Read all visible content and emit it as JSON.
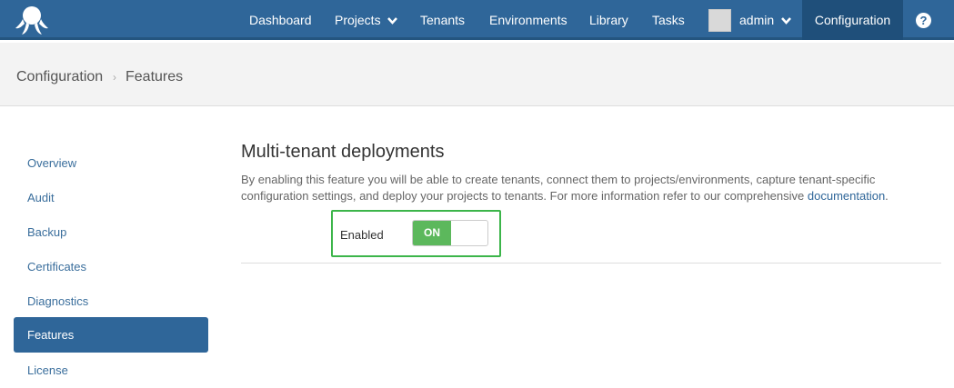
{
  "nav": {
    "items": [
      {
        "label": "Dashboard"
      },
      {
        "label": "Projects"
      },
      {
        "label": "Tenants"
      },
      {
        "label": "Environments"
      },
      {
        "label": "Library"
      },
      {
        "label": "Tasks"
      }
    ],
    "user": "admin",
    "configuration": "Configuration",
    "help": "?"
  },
  "breadcrumb": {
    "parent": "Configuration",
    "current": "Features"
  },
  "sidebar": {
    "items": [
      {
        "label": "Overview"
      },
      {
        "label": "Audit"
      },
      {
        "label": "Backup"
      },
      {
        "label": "Certificates"
      },
      {
        "label": "Diagnostics"
      },
      {
        "label": "Features",
        "active": true
      },
      {
        "label": "License"
      }
    ]
  },
  "feature": {
    "title": "Multi-tenant deployments",
    "description": "By enabling this feature you will be able to create tenants, connect them to projects/environments, capture tenant-specific configuration settings, and deploy your projects to tenants. For more information refer to our comprehensive",
    "link": "documentation",
    "link_suffix": ".",
    "toggle_label": "Enabled",
    "toggle_state": "ON"
  },
  "colors": {
    "nav_bg": "#2f6699",
    "active": "#1f4f7a",
    "toggle_on": "#5cb85c",
    "highlight": "#3cb54a"
  }
}
